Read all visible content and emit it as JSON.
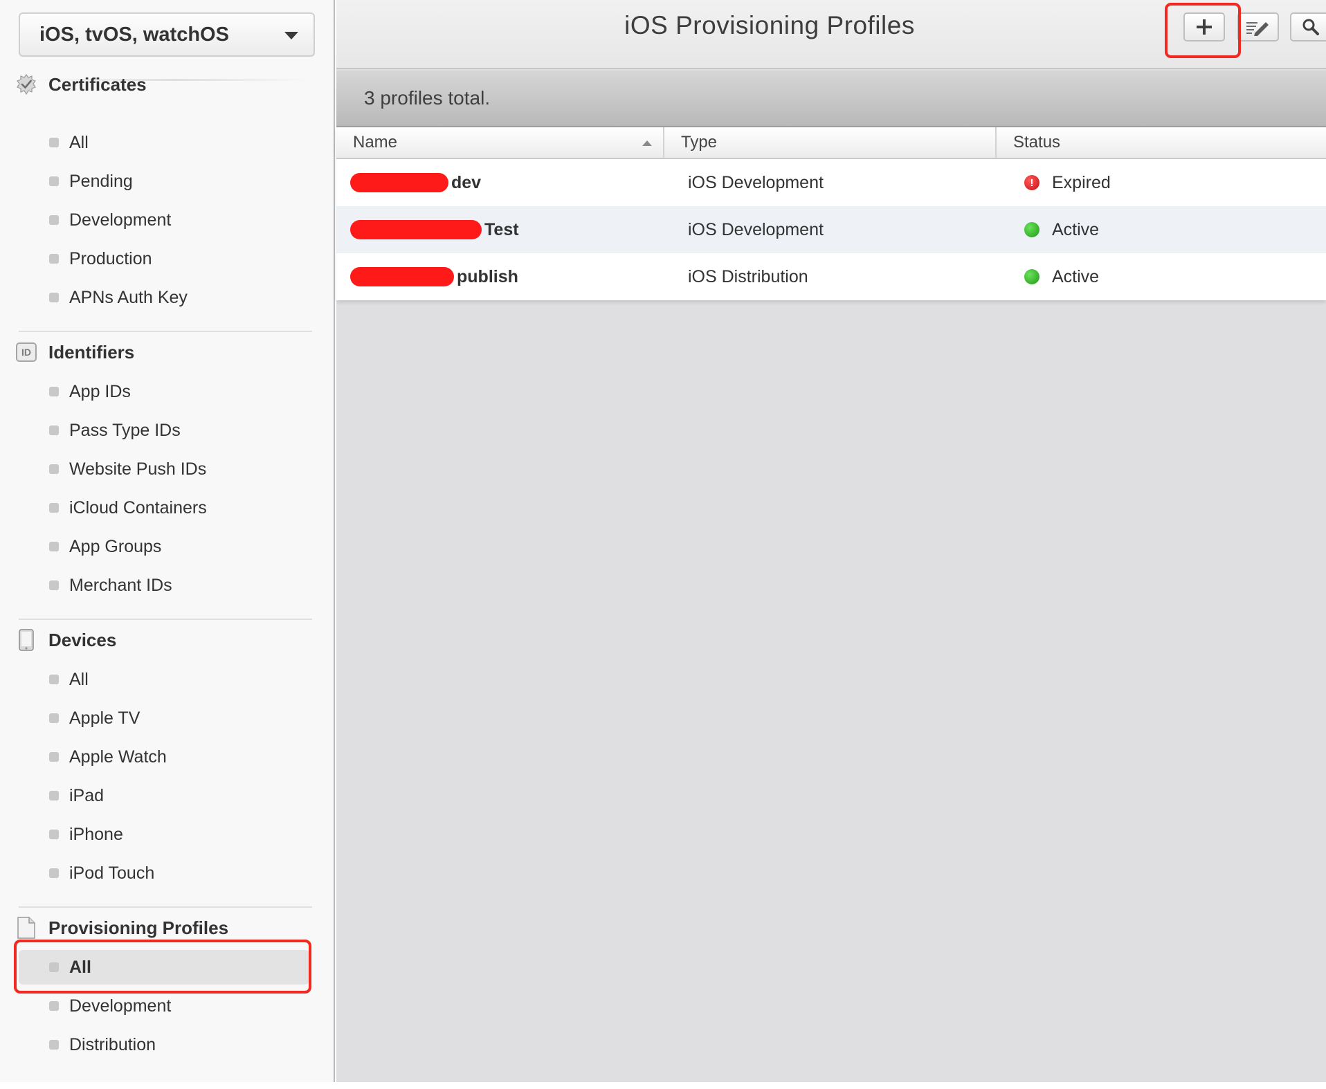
{
  "platform_select": {
    "label": "iOS, tvOS, watchOS"
  },
  "sidebar": {
    "certificates": {
      "title": "Certificates",
      "items": [
        "All",
        "Pending",
        "Development",
        "Production",
        "APNs Auth Key"
      ]
    },
    "identifiers": {
      "title": "Identifiers",
      "badge": "ID",
      "items": [
        "App IDs",
        "Pass Type IDs",
        "Website Push IDs",
        "iCloud Containers",
        "App Groups",
        "Merchant IDs"
      ]
    },
    "devices": {
      "title": "Devices",
      "items": [
        "All",
        "Apple TV",
        "Apple Watch",
        "iPad",
        "iPhone",
        "iPod Touch"
      ]
    },
    "provisioning_profiles": {
      "title": "Provisioning Profiles",
      "items": [
        "All",
        "Development",
        "Distribution"
      ],
      "selected": "All"
    }
  },
  "main": {
    "title": "iOS Provisioning Profiles",
    "toolbar": {
      "add_icon": "plus-icon",
      "edit_icon": "edit-icon",
      "search_icon": "search-icon"
    },
    "count_text": "3 profiles total.",
    "table": {
      "columns": [
        "Name",
        "Type",
        "Status"
      ],
      "rows": [
        {
          "name": "dev",
          "type": "iOS Development",
          "status": "Expired"
        },
        {
          "name": "Test",
          "type": "iOS Development",
          "status": "Active"
        },
        {
          "name": "publish",
          "type": "iOS Distribution",
          "status": "Active"
        }
      ]
    }
  },
  "colors": {
    "annotation_red": "#f02a20",
    "redaction_red": "#ff1a1a",
    "status_active": "#2fb326",
    "status_expired": "#d6161b"
  }
}
